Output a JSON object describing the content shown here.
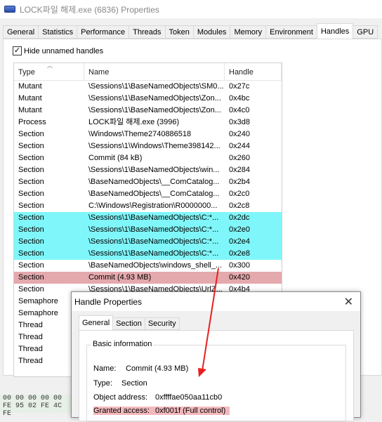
{
  "window": {
    "title": "LOCK파일 해제.exe (6836) Properties"
  },
  "tabs": [
    "General",
    "Statistics",
    "Performance",
    "Threads",
    "Token",
    "Modules",
    "Memory",
    "Environment",
    "Handles",
    "GPU"
  ],
  "active_tab_index": 8,
  "options": {
    "hide_unnamed_label": "Hide unnamed handles",
    "hide_unnamed_checked": true
  },
  "handles": {
    "columns": [
      "Type",
      "Name",
      "Handle"
    ],
    "rows": [
      {
        "type": "Mutant",
        "name": "\\Sessions\\1\\BaseNamedObjects\\SM0...",
        "handle": "0x27c",
        "hl": ""
      },
      {
        "type": "Mutant",
        "name": "\\Sessions\\1\\BaseNamedObjects\\Zon...",
        "handle": "0x4bc",
        "hl": ""
      },
      {
        "type": "Mutant",
        "name": "\\Sessions\\1\\BaseNamedObjects\\Zon...",
        "handle": "0x4c0",
        "hl": ""
      },
      {
        "type": "Process",
        "name": "LOCK파일 해제.exe (3996)",
        "handle": "0x3d8",
        "hl": ""
      },
      {
        "type": "Section",
        "name": "\\Windows\\Theme2740886518",
        "handle": "0x240",
        "hl": ""
      },
      {
        "type": "Section",
        "name": "\\Sessions\\1\\Windows\\Theme398142...",
        "handle": "0x244",
        "hl": ""
      },
      {
        "type": "Section",
        "name": "Commit (84 kB)",
        "handle": "0x260",
        "hl": ""
      },
      {
        "type": "Section",
        "name": "\\Sessions\\1\\BaseNamedObjects\\win...",
        "handle": "0x284",
        "hl": ""
      },
      {
        "type": "Section",
        "name": "\\BaseNamedObjects\\__ComCatalog...",
        "handle": "0x2b4",
        "hl": ""
      },
      {
        "type": "Section",
        "name": "\\BaseNamedObjects\\__ComCatalog...",
        "handle": "0x2c0",
        "hl": ""
      },
      {
        "type": "Section",
        "name": "C:\\Windows\\Registration\\R0000000...",
        "handle": "0x2c8",
        "hl": ""
      },
      {
        "type": "Section",
        "name": "\\Sessions\\1\\BaseNamedObjects\\C:*...",
        "handle": "0x2dc",
        "hl": "cyan"
      },
      {
        "type": "Section",
        "name": "\\Sessions\\1\\BaseNamedObjects\\C:*...",
        "handle": "0x2e0",
        "hl": "cyan"
      },
      {
        "type": "Section",
        "name": "\\Sessions\\1\\BaseNamedObjects\\C:*...",
        "handle": "0x2e4",
        "hl": "cyan"
      },
      {
        "type": "Section",
        "name": "\\Sessions\\1\\BaseNamedObjects\\C:*...",
        "handle": "0x2e8",
        "hl": "cyan"
      },
      {
        "type": "Section",
        "name": "\\BaseNamedObjects\\windows_shell_...",
        "handle": "0x300",
        "hl": ""
      },
      {
        "type": "Section",
        "name": "Commit (4.93 MB)",
        "handle": "0x420",
        "hl": "pink"
      },
      {
        "type": "Section",
        "name": "\\Sessions\\1\\BaseNamedObjects\\UrlZ...",
        "handle": "0x4b4",
        "hl": ""
      },
      {
        "type": "Semaphore",
        "name": "",
        "handle": "",
        "hl": ""
      },
      {
        "type": "Semaphore",
        "name": "",
        "handle": "",
        "hl": ""
      },
      {
        "type": "Thread",
        "name": "",
        "handle": "",
        "hl": ""
      },
      {
        "type": "Thread",
        "name": "",
        "handle": "",
        "hl": ""
      },
      {
        "type": "Thread",
        "name": "",
        "handle": "",
        "hl": ""
      },
      {
        "type": "Thread",
        "name": "",
        "handle": "",
        "hl": ""
      }
    ]
  },
  "hex": {
    "line1": "00 00 00 00 00",
    "line2": "FE 95 02 FE 4C",
    "line3": "FE"
  },
  "dialog": {
    "title": "Handle Properties",
    "close_glyph": "✕",
    "tabs": [
      "General",
      "Section",
      "Security"
    ],
    "group_label": "Basic information",
    "name_label": "Name:",
    "name_value": "Commit (4.93 MB)",
    "type_label": "Type:",
    "type_value": "Section",
    "address_label": "Object address:",
    "address_value": "0xffffae050aa11cb0",
    "access_label": "Granted access:",
    "access_value": "0xf001f (Full control)"
  },
  "colors": {
    "cyan_highlight": "#7ff6f9",
    "pink_highlight": "#e4a9ad",
    "arrow": "#e81f1f"
  }
}
